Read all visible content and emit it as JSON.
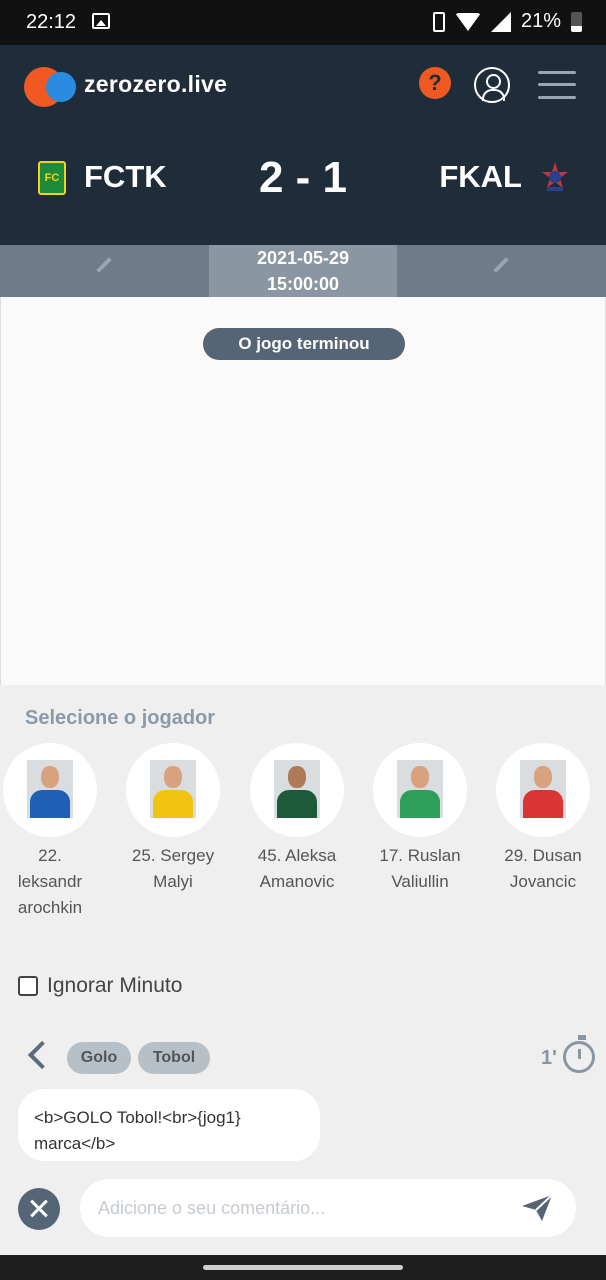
{
  "status_bar": {
    "time": "22:12",
    "battery": "21%"
  },
  "header": {
    "brand": "zerozero.live",
    "help_icon": "?",
    "home_team": {
      "code": "FCTK",
      "logo_text": "FC"
    },
    "score": "2 - 1",
    "away_team": {
      "code": "FKAL"
    }
  },
  "match": {
    "date": "2021-05-29",
    "time": "15:00:00",
    "status": "O jogo terminou"
  },
  "player_panel": {
    "title": "Selecione o jogador",
    "players": [
      {
        "line1": "22.",
        "line2": "leksandr",
        "line3": "arochkin",
        "shirt": "#1f5fb5"
      },
      {
        "line1": "25. Sergey",
        "line2": "Malyi",
        "line3": "",
        "shirt": "#f1c40f"
      },
      {
        "line1": "45. Aleksa",
        "line2": "Amanovic",
        "line3": "",
        "shirt": "#1d5a3a"
      },
      {
        "line1": "17. Ruslan",
        "line2": "Valiullin",
        "line3": "",
        "shirt": "#2e9e5a"
      },
      {
        "line1": "29. Dusan",
        "line2": "Jovancic",
        "line3": "",
        "shirt": "#d93535"
      }
    ]
  },
  "ignore_minute": {
    "label": "Ignorar Minuto",
    "checked": false
  },
  "event": {
    "tags": [
      "Golo",
      "Tobol"
    ],
    "minute": "1'",
    "template": "<b>GOLO Tobol!<br>{jog1} marca</b>"
  },
  "comment": {
    "placeholder": "Adicione o seu comentário..."
  },
  "colors": {
    "header_bg": "#1f2d3a",
    "accent_orange": "#f05a22",
    "accent_blue": "#2a8be0",
    "pill_bg": "#556576"
  }
}
